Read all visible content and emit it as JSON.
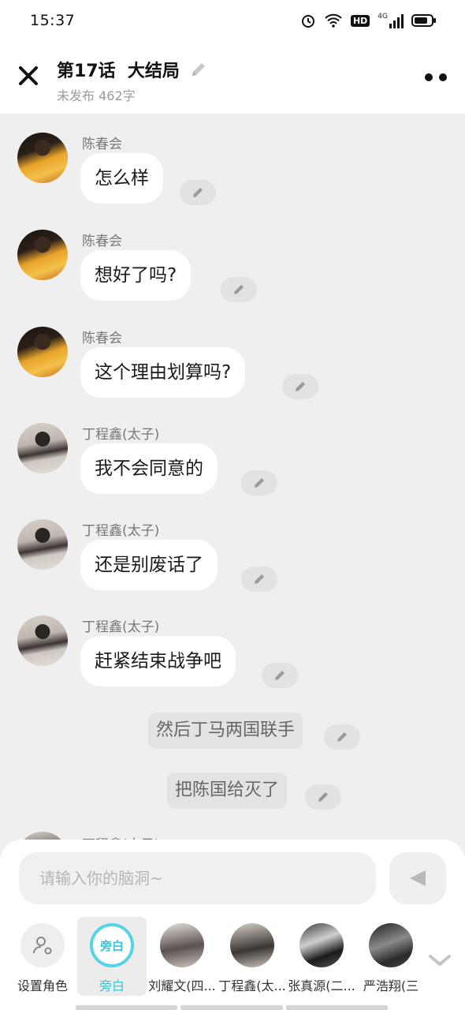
{
  "status": {
    "time": "15:37",
    "hd": "HD",
    "network": "4G"
  },
  "header": {
    "title": "第17话  大结局",
    "subtitle": "未发布 462字"
  },
  "messages": [
    {
      "sender": "陈春会",
      "text": "怎么样"
    },
    {
      "sender": "陈春会",
      "text": "想好了吗?"
    },
    {
      "sender": "陈春会",
      "text": "这个理由划算吗?"
    },
    {
      "sender": "丁程鑫(太子)",
      "text": "我不会同意的"
    },
    {
      "sender": "丁程鑫(太子)",
      "text": "还是别废话了"
    },
    {
      "sender": "丁程鑫(太子)",
      "text": "赶紧结束战争吧"
    }
  ],
  "narration": [
    {
      "text": "然后丁马两国联手"
    },
    {
      "text": "把陈国给灭了"
    }
  ],
  "peek": {
    "sender": "丁程鑫(太子)"
  },
  "composer": {
    "placeholder": "请输入你的脑洞~"
  },
  "roles": [
    {
      "label": "设置角色"
    },
    {
      "label": "旁白",
      "badge": "旁白"
    },
    {
      "label": "刘耀文(四..."
    },
    {
      "label": "丁程鑫(太..."
    },
    {
      "label": "张真源(二..."
    },
    {
      "label": "严浩翔(三"
    }
  ],
  "colors": {
    "accent": "#36c6d8",
    "background": "#efefef"
  }
}
